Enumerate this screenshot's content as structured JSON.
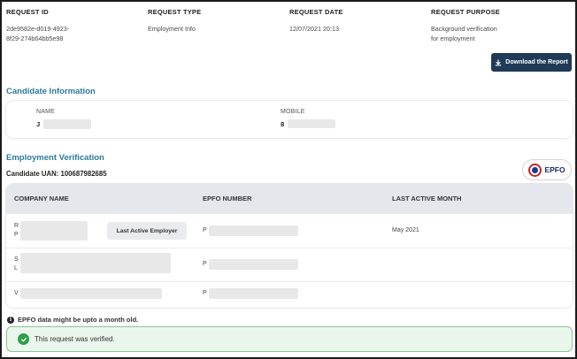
{
  "request": {
    "id_header": "REQUEST ID",
    "id_value_line1": "2de9582e-d019-4923-",
    "id_value_line2": "8f29-274b64bb5e98",
    "type_header": "REQUEST TYPE",
    "type_value": "Employment Info",
    "date_header": "REQUEST DATE",
    "date_value": "12/07/2021 20:13",
    "purpose_header": "REQUEST PURPOSE",
    "purpose_value_line1": "Background verification",
    "purpose_value_line2": "for employment"
  },
  "download_button": {
    "label": "Download the Report",
    "icon": "download-icon"
  },
  "candidate": {
    "section_title": "Candidate Information",
    "name_label": "NAME",
    "name_value": "J",
    "mobile_label": "MOBILE",
    "mobile_value": "8"
  },
  "employment": {
    "section_title": "Employment Verification",
    "uan_text": "Candidate UAN:  100687982685",
    "badge_label": "EPFO",
    "columns": [
      "COMPANY NAME",
      "EPFO NUMBER",
      "LAST ACTIVE MONTH"
    ],
    "rows": [
      {
        "company_line1": "R",
        "company_line2": "P",
        "epfo": "P",
        "last_active": "May 2021",
        "tag": "Last Active Employer"
      },
      {
        "company_line1": "S",
        "company_line2": "L",
        "epfo": "P",
        "last_active": "",
        "tag": ""
      },
      {
        "company_line1": "V",
        "company_line2": "",
        "epfo": "P",
        "last_active": "",
        "tag": ""
      }
    ],
    "note": "EPFO data might be upto a month old."
  },
  "status": {
    "message": "This request was verified.",
    "colors": {
      "success": "#2e9e4a",
      "success_bg": "#eaf6ec",
      "accent": "#2b7a9b",
      "button": "#1f3b57"
    }
  }
}
